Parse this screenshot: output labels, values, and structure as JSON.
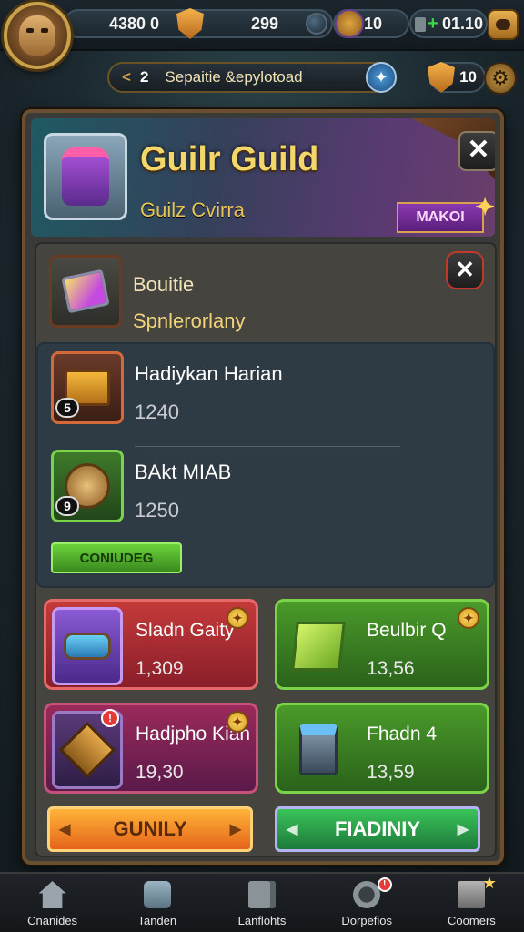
{
  "topbar": {
    "gold_value": "4380 0",
    "trophy_value": "299",
    "gems_value": "10",
    "energy_value": "01.10"
  },
  "quest": {
    "number": "2",
    "label": "Sepaitie &epylotoad",
    "rank_value": "10"
  },
  "guild": {
    "title": "Guilr Guild",
    "subtitle": "Guilz Cvirra",
    "make_button": "MAKOI"
  },
  "bounty": {
    "title": "Bouitie",
    "subtitle": "Spnlerorlany"
  },
  "list": [
    {
      "name": "Hadiykan Harian",
      "value": "1240",
      "level": "5"
    },
    {
      "name": "BAkt MIAB",
      "value": "1250",
      "level": "9"
    }
  ],
  "confirm_button": "CONIUDEG",
  "cards": [
    {
      "name": "Sladn Gaity",
      "value": "1,309",
      "badge": ""
    },
    {
      "name": "Beulbir Q",
      "value": "13,56",
      "badge": ""
    },
    {
      "name": "Hadjpho Kian",
      "value": "19,30",
      "badge": "!"
    },
    {
      "name": "Fhadn 4",
      "value": "13,59",
      "badge": ""
    }
  ],
  "buttons": {
    "left": "GUNILY",
    "right": "FIADINIY"
  },
  "nav": [
    {
      "label": "Cnanides",
      "icon": "house-icon"
    },
    {
      "label": "Tanden",
      "icon": "backpack-icon"
    },
    {
      "label": "Lanflohts",
      "icon": "book-icon"
    },
    {
      "label": "Dorpefios",
      "icon": "compass-icon"
    },
    {
      "label": "Coomers",
      "icon": "crate-icon"
    }
  ],
  "colors": {
    "gold_text": "#f4d76a",
    "panel_border": "#6a5030",
    "confirm_green": "#6ad23a",
    "orange_button": "#ffb43a",
    "green_button": "#3ac45a"
  }
}
